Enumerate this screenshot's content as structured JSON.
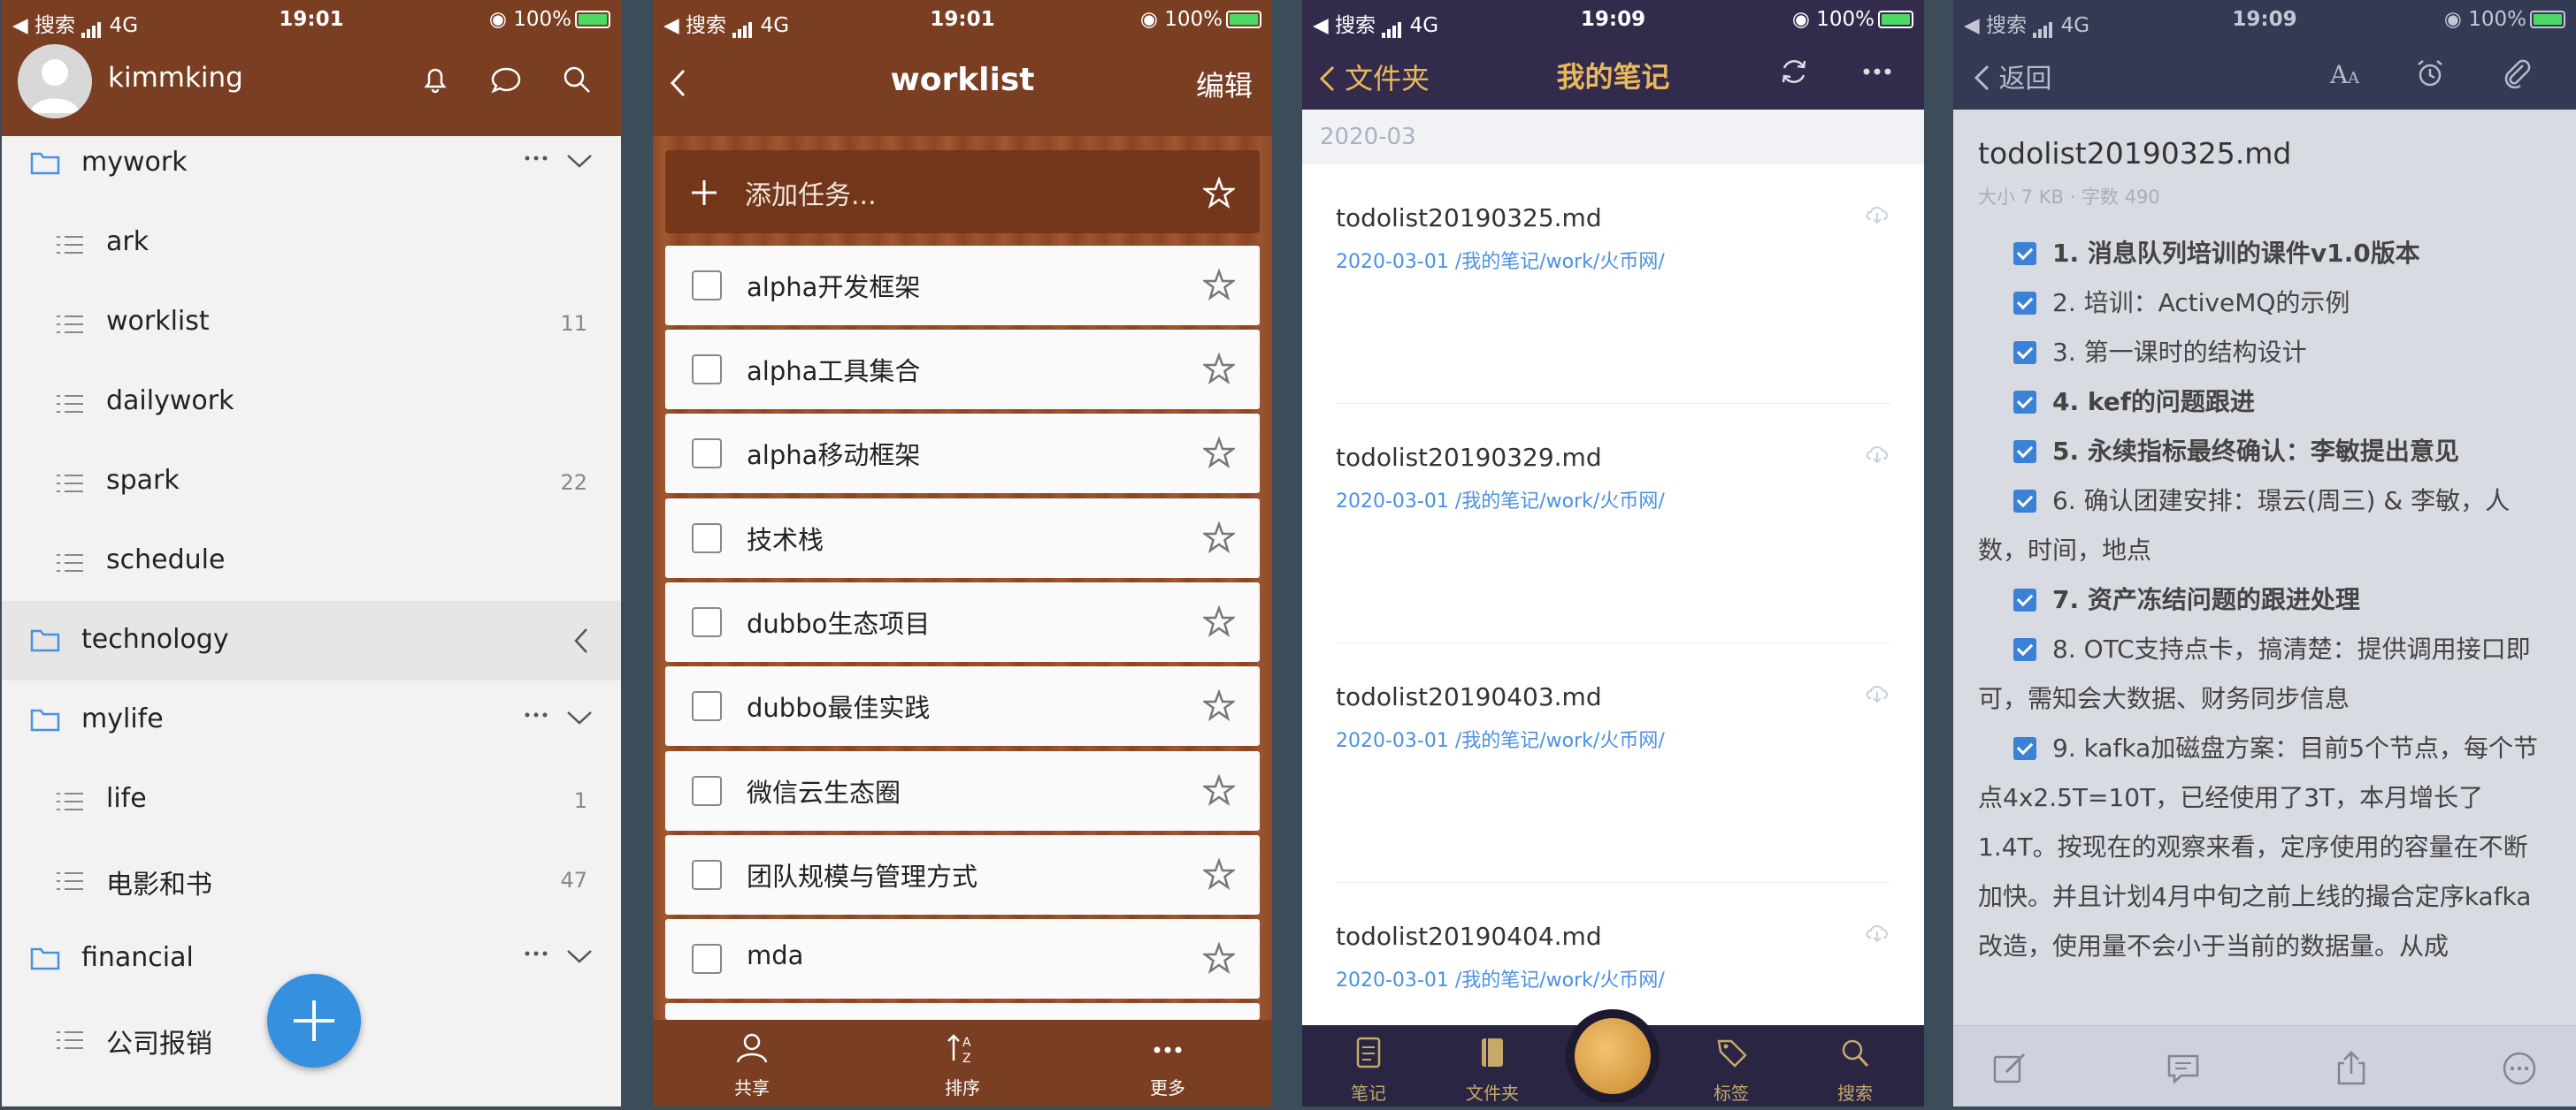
{
  "status": {
    "carrier_back": "◀ 搜索",
    "network": "4G",
    "battery": "100%",
    "time1": "19:01",
    "time2": "19:01",
    "time3": "19:09",
    "time4": "19:09"
  },
  "wunderlist": {
    "username": "kimmking",
    "groups": [
      {
        "name": "mywork",
        "lists": [
          {
            "name": "ark",
            "count": ""
          },
          {
            "name": "worklist",
            "count": "11"
          },
          {
            "name": "dailywork",
            "count": ""
          },
          {
            "name": "spark",
            "count": "22"
          },
          {
            "name": "schedule",
            "count": ""
          }
        ]
      },
      {
        "name": "technology",
        "lists": []
      },
      {
        "name": "mylife",
        "lists": [
          {
            "name": "life",
            "count": "1"
          },
          {
            "name": "电影和书",
            "count": "47"
          }
        ]
      },
      {
        "name": "financial",
        "lists": [
          {
            "name": "公司报销",
            "count": ""
          }
        ]
      }
    ]
  },
  "worklist": {
    "title": "worklist",
    "edit": "编辑",
    "add_task": "添加任务...",
    "tasks": [
      "alpha开发框架",
      "alpha工具集合",
      "alpha移动框架",
      "技术栈",
      "dubbo生态项目",
      "dubbo最佳实践",
      "微信云生态圈",
      "团队规模与管理方式",
      "mda"
    ],
    "tabs": [
      "共享",
      "排序",
      "更多"
    ]
  },
  "notes": {
    "back": "文件夹",
    "title": "我的笔记",
    "month": "2020-03",
    "items": [
      {
        "name": "todolist20190325.md",
        "meta": "2020-03-01 /我的笔记/work/火币网/"
      },
      {
        "name": "todolist20190329.md",
        "meta": "2020-03-01 /我的笔记/work/火币网/"
      },
      {
        "name": "todolist20190403.md",
        "meta": "2020-03-01 /我的笔记/work/火币网/"
      },
      {
        "name": "todolist20190404.md",
        "meta": "2020-03-01 /我的笔记/work/火币网/"
      }
    ],
    "tabs": [
      "笔记",
      "文件夹",
      "",
      "标签",
      "搜索"
    ]
  },
  "doc": {
    "back": "返回",
    "title": "todolist20190325.md",
    "meta": "大小 7 KB · 字数 490",
    "items": [
      {
        "text": "1. 消息队列培训的课件v1.0版本",
        "bold": true
      },
      {
        "text": "2. 培训：ActiveMQ的示例",
        "bold": false
      },
      {
        "text": "3. 第一课时的结构设计",
        "bold": false
      },
      {
        "text": "4. kef的问题跟进",
        "bold": true
      },
      {
        "text": "5. 永续指标最终确认：李敏提出意见",
        "bold": true
      },
      {
        "text": "6. 确认团建安排：璟云(周三) & 李敏，人数，时间，地点",
        "bold": false
      },
      {
        "text": "7. 资产冻结问题的跟进处理",
        "bold": true
      },
      {
        "text": "8. OTC支持点卡，搞清楚：提供调用接口即可，需知会大数据、财务同步信息",
        "bold": false
      },
      {
        "text": "9. kafka加磁盘方案：目前5个节点，每个节点4x2.5T=10T，已经使用了3T，本月增长了1.4T。按现在的观察来看，定序使用的容量在不断加快。并且计划4月中旬之前上线的撮合定序kafka改造，使用量不会小于当前的数据量。从成",
        "bold": false
      }
    ]
  },
  "colors": {
    "wunder_header": "#7a3e22",
    "notes_header": "#332b4c",
    "notes_accent": "#e9b85a",
    "link_blue": "#4a90e2",
    "fab_blue": "#3590e0"
  }
}
